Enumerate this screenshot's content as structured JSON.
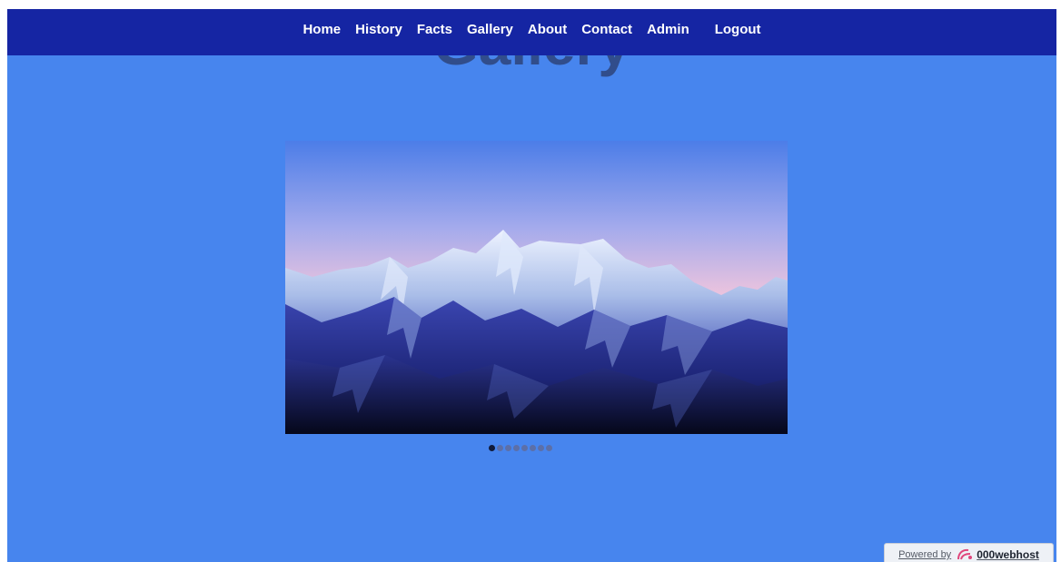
{
  "page": {
    "heading": "Gallery"
  },
  "nav": {
    "items": [
      {
        "label": "Home"
      },
      {
        "label": "History"
      },
      {
        "label": "Facts"
      },
      {
        "label": "Gallery"
      },
      {
        "label": "About"
      },
      {
        "label": "Contact"
      },
      {
        "label": "Admin"
      },
      {
        "label": "Logout"
      }
    ]
  },
  "slideshow": {
    "image_description": "snow-capped-mountain-range",
    "slide_count": 8,
    "active_index": 0
  },
  "footer_badge": {
    "prefix": "Powered by",
    "brand": "000webhost",
    "icon": "000webhost-logo-icon"
  },
  "colors": {
    "page_background": "#4785ee",
    "navbar": "#1525a3",
    "nav_text": "#ffffff",
    "heading": "#2a3b6b",
    "dot_active": "#101a3a",
    "dot_inactive": "#5c6fa8"
  }
}
